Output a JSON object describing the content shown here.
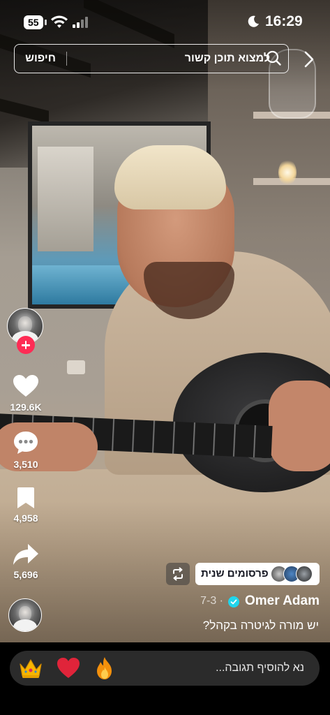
{
  "status_bar": {
    "battery": "55",
    "time": "16:29"
  },
  "search": {
    "placeholder": "למצוא תוכן קשור",
    "button_label": "חיפוש"
  },
  "actions": {
    "likes": "129.6K",
    "comments": "3,510",
    "saves": "4,958",
    "shares": "5,696"
  },
  "reposts": {
    "label": "3 פרסומים שנית",
    "avatar_count": 3
  },
  "post": {
    "author": "Omer Adam",
    "date": "7-3",
    "separator": "·",
    "caption": "יש מורה לגיטרה בקהל?",
    "verified": true
  },
  "comment_bar": {
    "placeholder": "נא להוסיף תגובה...",
    "quick_reactions": [
      "crown-emoji",
      "heart-emoji",
      "fire-emoji"
    ]
  },
  "colors": {
    "accent": "#fe2c55",
    "verified": "#20d5ec",
    "comment_bar_bg": "#2b2b2b"
  }
}
